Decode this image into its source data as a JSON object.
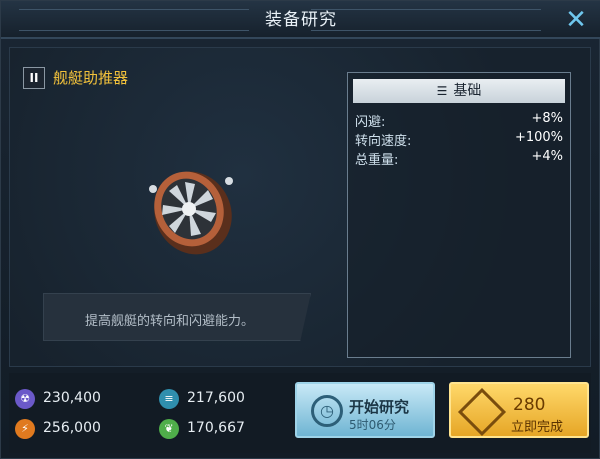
{
  "window": {
    "title": "装备研究"
  },
  "item": {
    "level": "II",
    "name": "舰艇助推器",
    "description": "提高舰艇的转向和闪避能力。"
  },
  "stats": {
    "header": "基础",
    "rows": [
      {
        "label": "闪避:",
        "value": "+8%"
      },
      {
        "label": "转向速度:",
        "value": "+100%"
      },
      {
        "label": "总重量:",
        "value": "+4%"
      }
    ]
  },
  "resources": [
    {
      "icon": "radiation-icon",
      "value": "230,400",
      "color": "#6b59c9"
    },
    {
      "icon": "lightning-icon",
      "value": "256,000",
      "color": "#e07a1f"
    },
    {
      "icon": "layers-icon",
      "value": "217,600",
      "color": "#2f8fae"
    },
    {
      "icon": "leaf-icon",
      "value": "170,667",
      "color": "#4fae4a"
    }
  ],
  "actions": {
    "start": {
      "label": "开始研究",
      "time": "5时06分"
    },
    "finish": {
      "cost": "280",
      "label": "立即完成"
    }
  },
  "colors": {
    "accent_gold": "#f3c23b",
    "start_button": "#8ecde6",
    "finish_button": "#f5bb3a"
  }
}
